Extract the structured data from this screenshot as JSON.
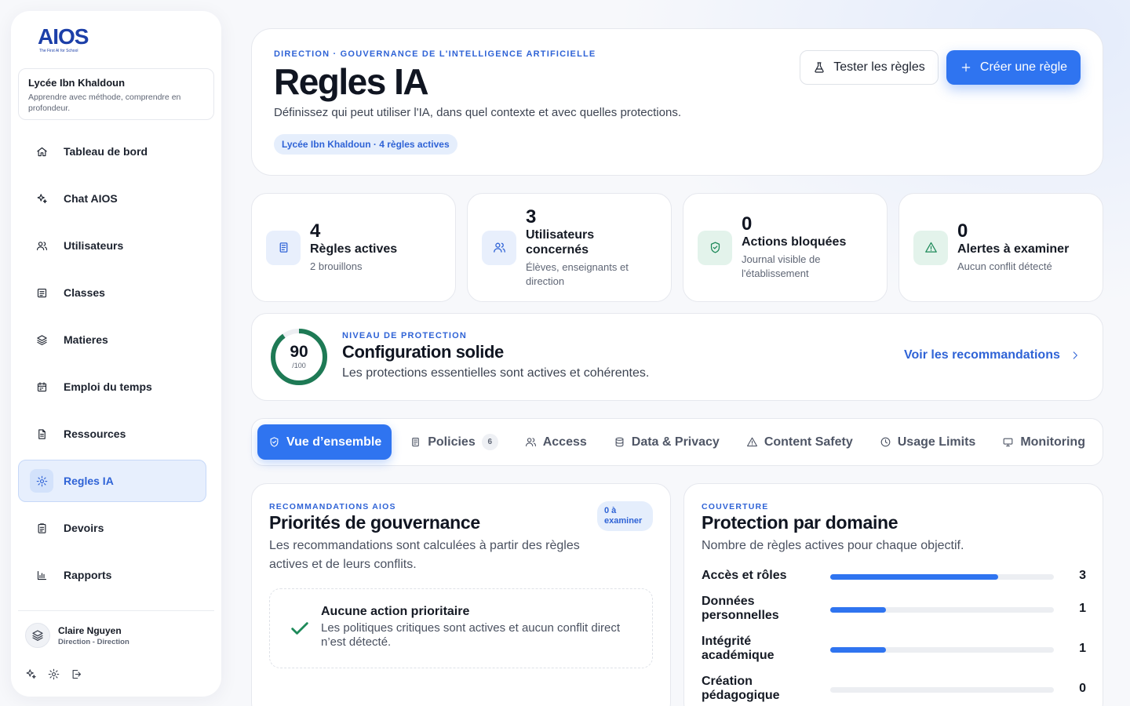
{
  "brand": {
    "logo": "AIOS",
    "tagline": "The First AI for School"
  },
  "school": {
    "name": "Lycée Ibn Khaldoun",
    "tagline": "Apprendre avec méthode, comprendre en profondeur."
  },
  "sidebar": {
    "items": [
      {
        "label": "Tableau de bord",
        "icon": "home-icon"
      },
      {
        "label": "Chat AIOS",
        "icon": "sparkles-icon"
      },
      {
        "label": "Utilisateurs",
        "icon": "users-icon"
      },
      {
        "label": "Classes",
        "icon": "board-icon"
      },
      {
        "label": "Matieres",
        "icon": "layers-icon"
      },
      {
        "label": "Emploi du temps",
        "icon": "calendar-icon"
      },
      {
        "label": "Ressources",
        "icon": "file-icon"
      },
      {
        "label": "Regles IA",
        "icon": "gear-icon",
        "active": true
      },
      {
        "label": "Devoirs",
        "icon": "clipboard-icon"
      },
      {
        "label": "Rapports",
        "icon": "bar-chart-icon"
      }
    ]
  },
  "user": {
    "name": "Claire Nguyen",
    "role": "Direction - Direction"
  },
  "header": {
    "kicker": "DIRECTION · GOUVERNANCE DE L'INTELLIGENCE ARTIFICIELLE",
    "title": "Regles IA",
    "description": "Définissez qui peut utiliser l'IA, dans quel contexte et avec quelles protections.",
    "pill": "Lycée Ibn Khaldoun · 4 règles actives",
    "test_label": "Tester les règles",
    "create_label": "Créer une règle"
  },
  "stats": [
    {
      "value": "4",
      "label": "Règles actives",
      "sub": "2 brouillons",
      "icon": "document-icon",
      "color": "#2f63d6",
      "bg": "#e8effc"
    },
    {
      "value": "3",
      "label": "Utilisateurs concernés",
      "sub": "Élèves, enseignants et direction",
      "icon": "users-icon",
      "color": "#2f63d6",
      "bg": "#e8effc"
    },
    {
      "value": "0",
      "label": "Actions bloquées",
      "sub": "Journal visible de l'établissement",
      "icon": "shield-check-icon",
      "color": "#1e8a5a",
      "bg": "#e3f3eb"
    },
    {
      "value": "0",
      "label": "Alertes à examiner",
      "sub": "Aucun conflit détecté",
      "icon": "warning-icon",
      "color": "#1e8a5a",
      "bg": "#e3f3eb"
    }
  ],
  "protection": {
    "score": 90,
    "max_label": "/100",
    "kicker": "NIVEAU DE PROTECTION",
    "title": "Configuration solide",
    "description": "Les protections essentielles sont actives et cohérentes.",
    "link": "Voir les recommandations",
    "color": "#1e7a55"
  },
  "tabs": [
    {
      "label": "Vue d’ensemble",
      "icon": "shield-check-icon",
      "active": true
    },
    {
      "label": "Policies",
      "icon": "document-icon",
      "badge": "6"
    },
    {
      "label": "Access",
      "icon": "users-icon"
    },
    {
      "label": "Data & Privacy",
      "icon": "database-icon"
    },
    {
      "label": "Content Safety",
      "icon": "warning-icon"
    },
    {
      "label": "Usage Limits",
      "icon": "clock-icon"
    },
    {
      "label": "Monitoring",
      "icon": "monitor-icon"
    }
  ],
  "recommendations": {
    "kicker": "RECOMMANDATIONS AIOS",
    "title": "Priorités de gouvernance",
    "description": "Les recommandations sont calculées à partir des règles actives et de leurs conflits.",
    "badge": "0 à examiner",
    "empty_title": "Aucune action prioritaire",
    "empty_desc": "Les politiques critiques sont actives et aucun conflit direct n’est détecté."
  },
  "coverage": {
    "kicker": "COUVERTURE",
    "title": "Protection par domaine",
    "description": "Nombre de règles actives pour chaque objectif.",
    "domains": [
      {
        "name": "Accès et rôles",
        "count": "3",
        "fraction": 0.75
      },
      {
        "name": "Données personnelles",
        "count": "1",
        "fraction": 0.25
      },
      {
        "name": "Intégrité académique",
        "count": "1",
        "fraction": 0.25
      },
      {
        "name": "Création pédagogique",
        "count": "0",
        "fraction": 0
      }
    ]
  }
}
